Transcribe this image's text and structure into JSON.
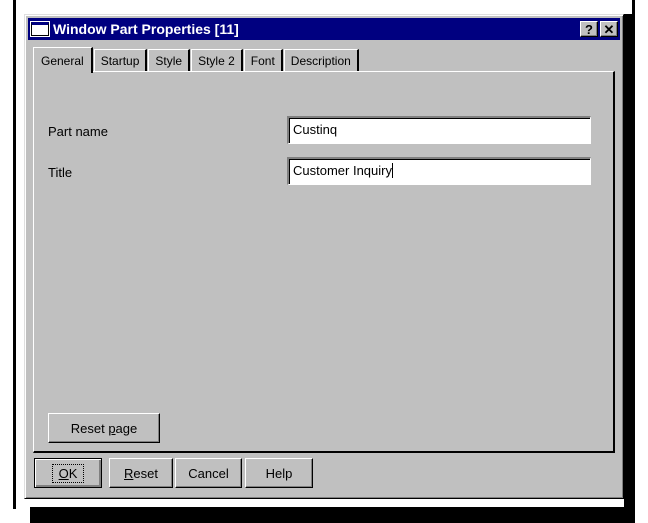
{
  "window": {
    "title": "Window Part Properties [11]",
    "help_glyph": "?",
    "close_glyph": "✕"
  },
  "tabs": [
    {
      "label": "General",
      "active": true
    },
    {
      "label": "Startup"
    },
    {
      "label": "Style"
    },
    {
      "label": "Style 2"
    },
    {
      "label": "Font"
    },
    {
      "label": "Description"
    }
  ],
  "general": {
    "part_name_label": "Part name",
    "part_name_value": "Custinq",
    "title_label": "Title",
    "title_value": "Customer Inquiry"
  },
  "buttons": {
    "reset_page": {
      "before": "Reset ",
      "mnemonic": "p",
      "after": "age"
    },
    "ok": {
      "before": "",
      "mnemonic": "O",
      "after": "K"
    },
    "reset": {
      "before": "",
      "mnemonic": "R",
      "after": "eset"
    },
    "cancel": "Cancel",
    "help": "Help"
  },
  "colors": {
    "titlebar": "#000080",
    "face": "#c0c0c0"
  }
}
